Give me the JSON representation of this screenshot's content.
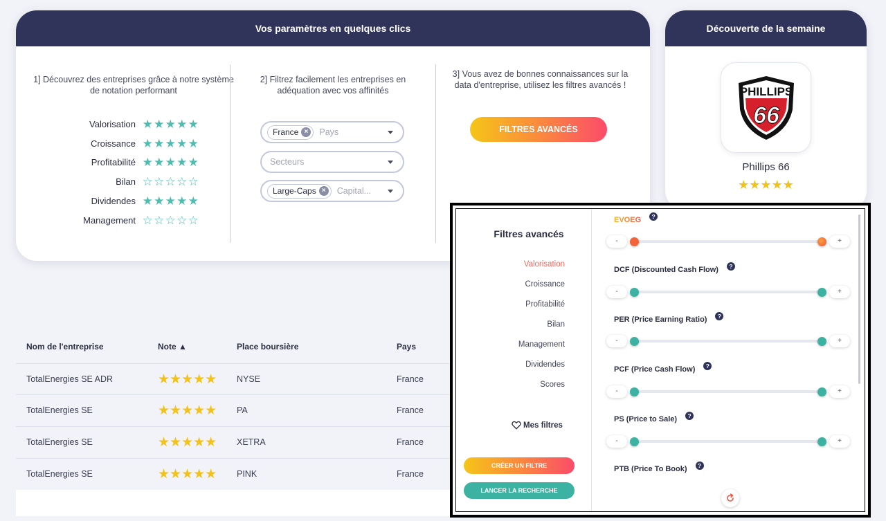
{
  "params_card": {
    "title": "Vos paramètres en quelques clics",
    "col1_title": "1] Découvrez des entreprises grâce à notre système de notation performant",
    "col2_title": "2] Filtrez facilement les entreprises en adéquation avec vos affinités",
    "col3_title": "3] Vous avez de bonnes connaissances sur la data d'entreprise, utilisez les filtres avancés !",
    "ratings": [
      {
        "label": "Valorisation",
        "stars": 5
      },
      {
        "label": "Croissance",
        "stars": 5
      },
      {
        "label": "Profitabilité",
        "stars": 5
      },
      {
        "label": "Bilan",
        "stars": 0
      },
      {
        "label": "Dividendes",
        "stars": 5
      },
      {
        "label": "Management",
        "stars": 0
      }
    ],
    "filters": {
      "country_chip": "France",
      "country_placeholder": "Pays",
      "sector_placeholder": "Secteurs",
      "cap_chip": "Large-Caps",
      "cap_placeholder": "Capital..."
    },
    "advanced_button": "FILTRES AVANCÉS"
  },
  "discovery": {
    "title": "Découverte de la semaine",
    "logo_top": "PHILLIPS",
    "logo_number": "66",
    "company": "Phillips 66",
    "stars": 5
  },
  "table": {
    "headers": {
      "name": "Nom de l'entreprise",
      "note": "Note ▲",
      "exchange": "Place boursière",
      "country": "Pays"
    },
    "rows": [
      {
        "name": "TotalEnergies SE ADR",
        "stars": "★★★★★",
        "exchange": "NYSE",
        "country": "France"
      },
      {
        "name": "TotalEnergies SE",
        "stars": "★★★★★",
        "exchange": "PA",
        "country": "France"
      },
      {
        "name": "TotalEnergies SE",
        "stars": "★★★★★",
        "exchange": "XETRA",
        "country": "France"
      },
      {
        "name": "TotalEnergies SE",
        "stars": "★★★★★",
        "exchange": "PINK",
        "country": "France"
      }
    ]
  },
  "advanced": {
    "title": "Filtres avancés",
    "nav": [
      "Valorisation",
      "Croissance",
      "Profitabilité",
      "Bilan",
      "Management",
      "Dividendes",
      "Scores"
    ],
    "active_nav": "Valorisation",
    "my_filters": "Mes filtres",
    "create_button": "CRÉER UN FILTRE",
    "search_button": "LANCER LA RECHERCHE",
    "criteria": [
      {
        "label": "EVOEG",
        "min": 0,
        "max": 1
      },
      {
        "label": "DCF  (Discounted Cash Flow)",
        "min": 0,
        "max": 1
      },
      {
        "label": "PER  (Price Earning Ratio)",
        "min": 0,
        "max": 1
      },
      {
        "label": "PCF  (Price Cash Flow)",
        "min": 0,
        "max": 1
      },
      {
        "label": "PS  (Price to Sale)",
        "min": 0,
        "max": 1
      },
      {
        "label": "PTB  (Price To Book)"
      }
    ],
    "minus": "-",
    "plus": "+",
    "help": "?",
    "colors": {
      "accent": "#3cb3a2",
      "active": "#f2675e",
      "header": "#30335a",
      "gold": "#f2c21b"
    }
  }
}
